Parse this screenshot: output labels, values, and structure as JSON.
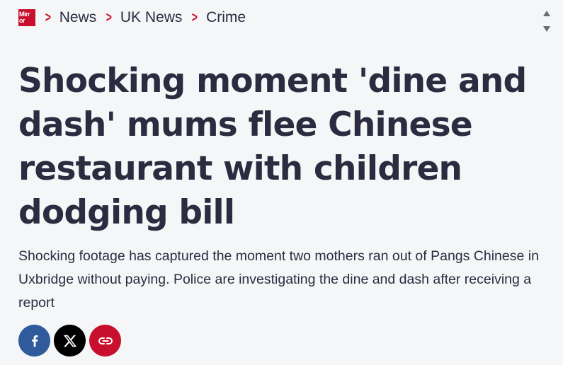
{
  "brand": {
    "logo_line1": "Mirr",
    "logo_line2": "or",
    "accent_color": "#c8102e",
    "text_color": "#2c2b40"
  },
  "breadcrumb": {
    "items": [
      {
        "label": "News"
      },
      {
        "label": "UK News"
      },
      {
        "label": "Crime"
      }
    ]
  },
  "article": {
    "headline": "Shocking moment 'dine and dash' mums flee Chinese restaurant with children dodging bill",
    "standfirst": "Shocking footage has captured the moment two mothers ran out of Pangs Chinese in Uxbridge without paying. Police are investigating the dine and dash after receiving a report"
  },
  "share": {
    "buttons": [
      {
        "icon": "facebook-icon",
        "color": "#2f5a9c"
      },
      {
        "icon": "x-icon",
        "color": "#000000"
      },
      {
        "icon": "link-icon",
        "color": "#c8102e"
      }
    ]
  },
  "scrollbar": {
    "up_icon": "chevron-up-icon",
    "down_icon": "chevron-down-icon"
  }
}
